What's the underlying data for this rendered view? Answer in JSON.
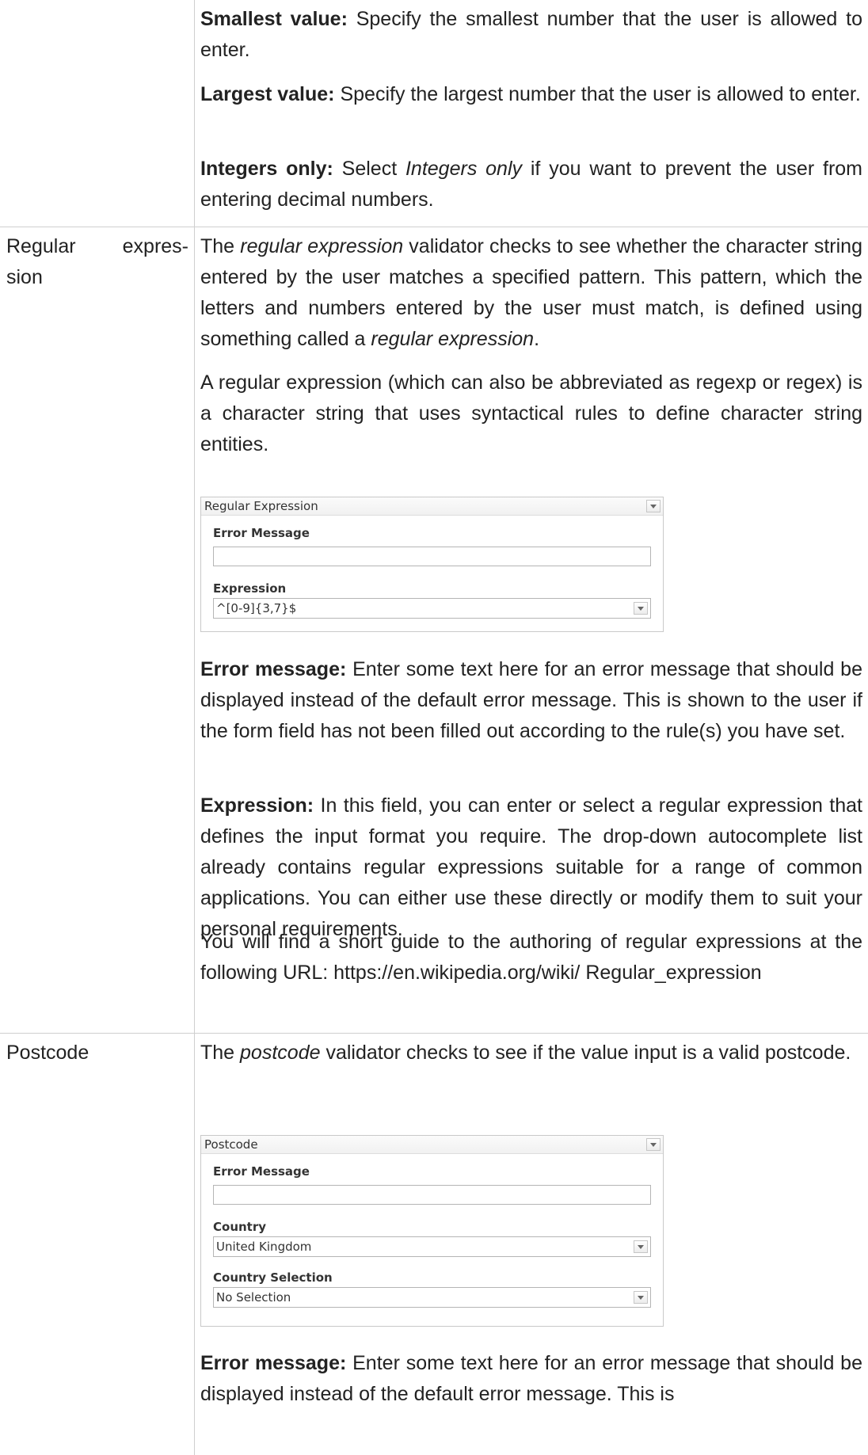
{
  "top_section": {
    "smallest_label": "Smallest value:",
    "smallest_text": " Specify the smallest number that the user is allowed to enter.",
    "largest_label": "Largest value:",
    "largest_text": " Specify the largest number that the user is allowed to enter.",
    "integers_label": "Integers only:",
    "integers_pre": " Select ",
    "integers_em": "Integers only",
    "integers_post": " if you want to prevent the user from entering decimal numbers."
  },
  "regex_row": {
    "label_line1": "Regular expres-",
    "label_line2": "sion",
    "intro_pre": "The ",
    "intro_em1": "regular expression",
    "intro_mid": " validator checks to see whether the char­acter string entered by the user matches a specified pattern. This pattern, which the letters and numbers entered by the user must match, is defined using something called a ",
    "intro_em2": "regular expression",
    "intro_post": ".",
    "definition": "A regular expression (which can also be abbreviated as regexp or regex) is a character string that uses syntactical rules to define character string entities.",
    "panel": {
      "title": "Regular Expression",
      "error_label": "Error Message",
      "error_value": "",
      "expression_label": "Expression",
      "expression_value": "^[0-9]{3,7}$"
    },
    "error_label": "Error message:",
    "error_text": " Enter some text here for an error message that should be displayed instead of the default error message. This is shown to the user if the form field has not been filled out according to the rule(s) you have set.",
    "expression_label": "Expression:",
    "expression_text": " In this field, you can enter or select a regular expres­sion that defines the input format you require. The drop-down autocomplete list already contains regular expressions suitable for a range of common applications. You can either use these directly or modify them to suit your personal requirements.",
    "guide_text": "You will find a short guide to the authoring of regular expressions at the following URL: https://en.wikipedia.org/wiki/ Regular_expression"
  },
  "postcode_row": {
    "label": "Postcode",
    "intro_pre": "The ",
    "intro_em": "postcode",
    "intro_post": " validator checks to see if the value input is a valid postcode.",
    "panel": {
      "title": "Postcode",
      "error_label": "Error Message",
      "error_value": "",
      "country_label": "Country",
      "country_value": "United Kingdom",
      "country_selection_label": "Country Selection",
      "country_selection_value": "No Selection"
    },
    "error_label": "Error message:",
    "error_text": " Enter some text here for an error message that should be displayed instead of the default error message. This is"
  }
}
